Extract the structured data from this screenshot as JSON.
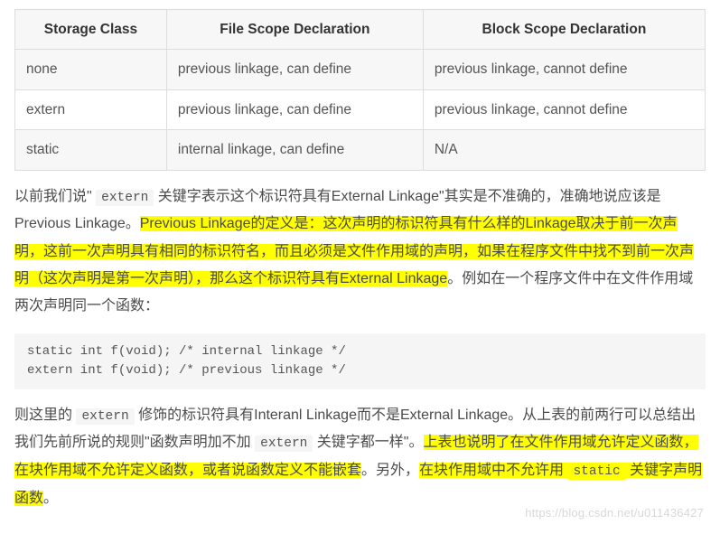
{
  "table": {
    "headers": [
      "Storage Class",
      "File Scope Declaration",
      "Block Scope Declaration"
    ],
    "rows": [
      [
        "none",
        "previous linkage, can define",
        "previous linkage, cannot define"
      ],
      [
        "extern",
        "previous linkage, can define",
        "previous linkage, cannot define"
      ],
      [
        "static",
        "internal linkage, can define",
        "N/A"
      ]
    ]
  },
  "para1": {
    "s1a": "以前我们说\" ",
    "s1code": "extern",
    "s1b": " 关键字表示这个标识符具有External Linkage\"其实是不准确的，准确地说应该是Previous Linkage。",
    "hl1": "Previous Linkage的定义是：这次声明的标识符具有什么样的Linkage取决于前一次声明，这前一次声明具有相同的标识符名，而且必须是文件作用域的声明，如果在程序文件中找不到前一次声明（这次声明是第一次声明），那么这个标识符具有External Linkage",
    "s2": "。例如在一个程序文件中在文件作用域两次声明同一个函数："
  },
  "codeblock": "static int f(void); /* internal linkage */\nextern int f(void); /* previous linkage */",
  "para2": {
    "s1a": "则这里的 ",
    "s1code": "extern",
    "s1b": " 修饰的标识符具有Interanl Linkage而不是External Linkage。从上表的前两行可以总结出我们先前所说的规则\"函数声明加不加 ",
    "s1code2": "extern",
    "s1c": " 关键字都一样\"。",
    "hl2": "上表也说明了在文件作用域允许定义函数，在块作用域不允许定义函数，或者说函数定义不能嵌套",
    "s2a": "。另外，",
    "hl3a": "在块作用域中不允许用 ",
    "hl3code": "static",
    "hl3b": " 关键字声明函数",
    "s2b": "。"
  },
  "watermark": "https://blog.csdn.net/u011436427"
}
